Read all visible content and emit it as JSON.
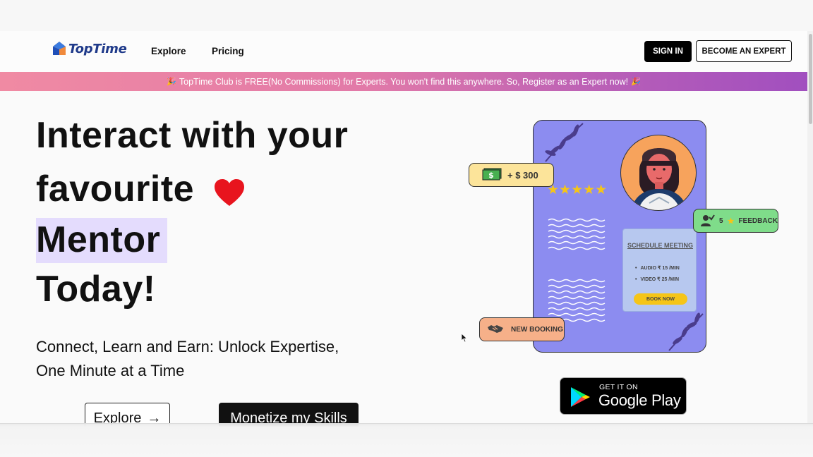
{
  "header": {
    "brand": "TopTime",
    "nav": [
      "Explore",
      "Pricing"
    ],
    "sign_in": "SIGN IN",
    "become_expert": "BECOME AN EXPERT"
  },
  "banner": {
    "text": "TopTime Club is FREE(No Commissions) for Experts. You won't find this anywhere. So, Register as an Expert now!",
    "icon": "party-popper-icon"
  },
  "hero": {
    "line1": "Interact with your",
    "line2": "favourite",
    "line3": "Mentor",
    "line4": "Today!",
    "sub1": "Connect, Learn and Earn: Unlock Expertise,",
    "sub2": "One Minute at a Time",
    "explore_btn": "Explore",
    "explore_arrow": "→",
    "monetize_btn": "Monetize my Skills"
  },
  "illustration": {
    "money_badge": "+ $ 300",
    "stars": "★★★★★",
    "star_rating": 5,
    "feedback_count": "5",
    "feedback_label": "FEEDBACK",
    "schedule_title": "SCHEDULE MEETING",
    "audio_rate": "AUDIO ₹ 15 /MIN",
    "video_rate": "VIDEO ₹ 25 /MIN",
    "book_now": "BOOK NOW",
    "new_booking": "NEW BOOKING"
  },
  "store_badge": {
    "small": "GET IT ON",
    "big": "Google Play"
  },
  "colors": {
    "card": "#8c8cf0",
    "mentor_highlight": "#e4dcfd",
    "heart": "#e8141e",
    "banner_start": "#f08aa3",
    "banner_end": "#a14fbf"
  }
}
